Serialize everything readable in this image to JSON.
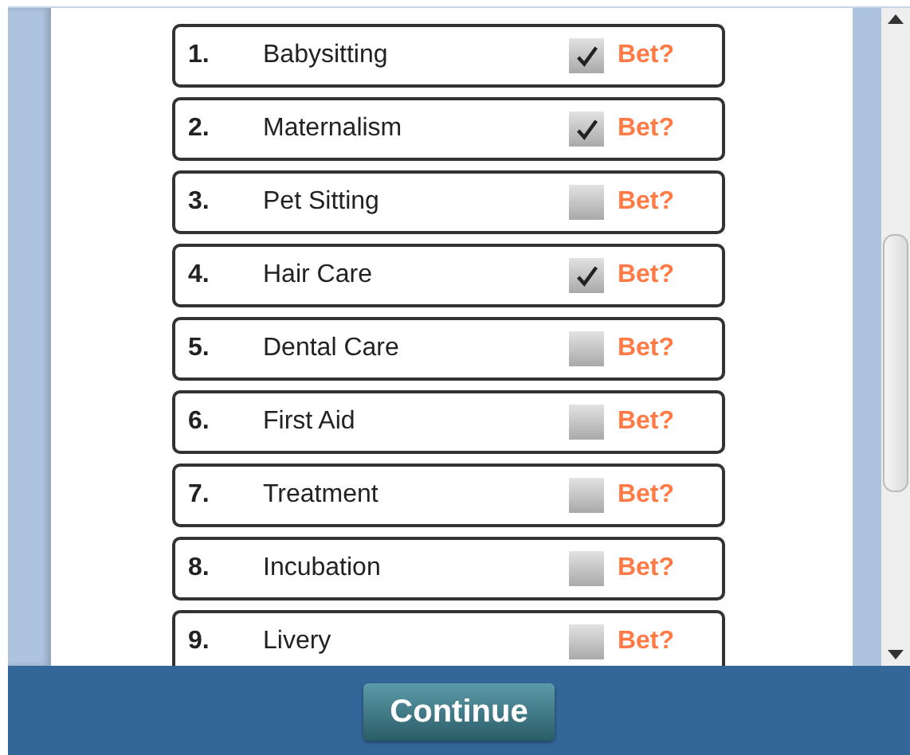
{
  "items": [
    {
      "number": "1.",
      "label": "Babysitting",
      "checked": true,
      "bet_label": "Bet?"
    },
    {
      "number": "2.",
      "label": "Maternalism",
      "checked": true,
      "bet_label": "Bet?"
    },
    {
      "number": "3.",
      "label": "Pet Sitting",
      "checked": false,
      "bet_label": "Bet?"
    },
    {
      "number": "4.",
      "label": "Hair Care",
      "checked": true,
      "bet_label": "Bet?"
    },
    {
      "number": "5.",
      "label": "Dental Care",
      "checked": false,
      "bet_label": "Bet?"
    },
    {
      "number": "6.",
      "label": "First Aid",
      "checked": false,
      "bet_label": "Bet?"
    },
    {
      "number": "7.",
      "label": "Treatment",
      "checked": false,
      "bet_label": "Bet?"
    },
    {
      "number": "8.",
      "label": "Incubation",
      "checked": false,
      "bet_label": "Bet?"
    },
    {
      "number": "9.",
      "label": "Livery",
      "checked": false,
      "bet_label": "Bet?"
    }
  ],
  "footer": {
    "button": "Continue"
  }
}
